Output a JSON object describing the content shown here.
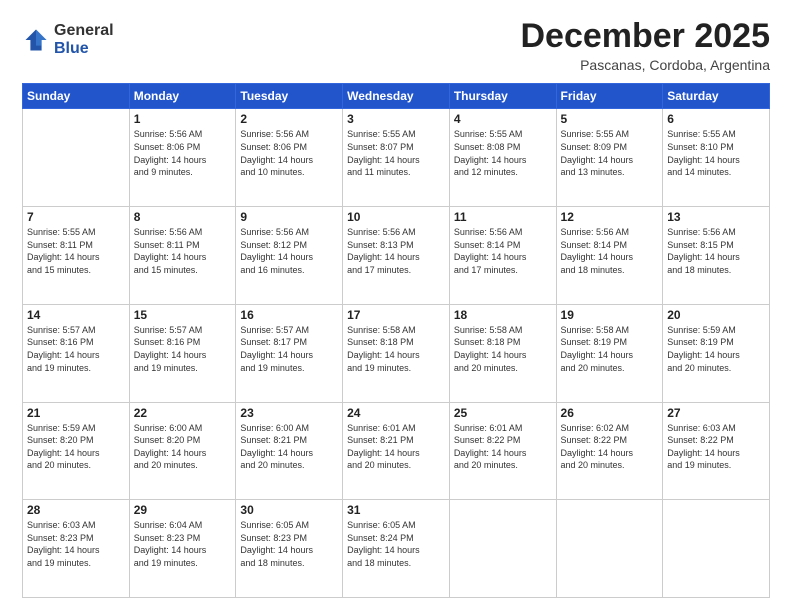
{
  "logo": {
    "general": "General",
    "blue": "Blue"
  },
  "header": {
    "month": "December 2025",
    "location": "Pascanas, Cordoba, Argentina"
  },
  "days_of_week": [
    "Sunday",
    "Monday",
    "Tuesday",
    "Wednesday",
    "Thursday",
    "Friday",
    "Saturday"
  ],
  "weeks": [
    [
      {
        "day": "",
        "info": ""
      },
      {
        "day": "1",
        "info": "Sunrise: 5:56 AM\nSunset: 8:06 PM\nDaylight: 14 hours\nand 9 minutes."
      },
      {
        "day": "2",
        "info": "Sunrise: 5:56 AM\nSunset: 8:06 PM\nDaylight: 14 hours\nand 10 minutes."
      },
      {
        "day": "3",
        "info": "Sunrise: 5:55 AM\nSunset: 8:07 PM\nDaylight: 14 hours\nand 11 minutes."
      },
      {
        "day": "4",
        "info": "Sunrise: 5:55 AM\nSunset: 8:08 PM\nDaylight: 14 hours\nand 12 minutes."
      },
      {
        "day": "5",
        "info": "Sunrise: 5:55 AM\nSunset: 8:09 PM\nDaylight: 14 hours\nand 13 minutes."
      },
      {
        "day": "6",
        "info": "Sunrise: 5:55 AM\nSunset: 8:10 PM\nDaylight: 14 hours\nand 14 minutes."
      }
    ],
    [
      {
        "day": "7",
        "info": "Sunrise: 5:55 AM\nSunset: 8:11 PM\nDaylight: 14 hours\nand 15 minutes."
      },
      {
        "day": "8",
        "info": "Sunrise: 5:56 AM\nSunset: 8:11 PM\nDaylight: 14 hours\nand 15 minutes."
      },
      {
        "day": "9",
        "info": "Sunrise: 5:56 AM\nSunset: 8:12 PM\nDaylight: 14 hours\nand 16 minutes."
      },
      {
        "day": "10",
        "info": "Sunrise: 5:56 AM\nSunset: 8:13 PM\nDaylight: 14 hours\nand 17 minutes."
      },
      {
        "day": "11",
        "info": "Sunrise: 5:56 AM\nSunset: 8:14 PM\nDaylight: 14 hours\nand 17 minutes."
      },
      {
        "day": "12",
        "info": "Sunrise: 5:56 AM\nSunset: 8:14 PM\nDaylight: 14 hours\nand 18 minutes."
      },
      {
        "day": "13",
        "info": "Sunrise: 5:56 AM\nSunset: 8:15 PM\nDaylight: 14 hours\nand 18 minutes."
      }
    ],
    [
      {
        "day": "14",
        "info": "Sunrise: 5:57 AM\nSunset: 8:16 PM\nDaylight: 14 hours\nand 19 minutes."
      },
      {
        "day": "15",
        "info": "Sunrise: 5:57 AM\nSunset: 8:16 PM\nDaylight: 14 hours\nand 19 minutes."
      },
      {
        "day": "16",
        "info": "Sunrise: 5:57 AM\nSunset: 8:17 PM\nDaylight: 14 hours\nand 19 minutes."
      },
      {
        "day": "17",
        "info": "Sunrise: 5:58 AM\nSunset: 8:18 PM\nDaylight: 14 hours\nand 19 minutes."
      },
      {
        "day": "18",
        "info": "Sunrise: 5:58 AM\nSunset: 8:18 PM\nDaylight: 14 hours\nand 20 minutes."
      },
      {
        "day": "19",
        "info": "Sunrise: 5:58 AM\nSunset: 8:19 PM\nDaylight: 14 hours\nand 20 minutes."
      },
      {
        "day": "20",
        "info": "Sunrise: 5:59 AM\nSunset: 8:19 PM\nDaylight: 14 hours\nand 20 minutes."
      }
    ],
    [
      {
        "day": "21",
        "info": "Sunrise: 5:59 AM\nSunset: 8:20 PM\nDaylight: 14 hours\nand 20 minutes."
      },
      {
        "day": "22",
        "info": "Sunrise: 6:00 AM\nSunset: 8:20 PM\nDaylight: 14 hours\nand 20 minutes."
      },
      {
        "day": "23",
        "info": "Sunrise: 6:00 AM\nSunset: 8:21 PM\nDaylight: 14 hours\nand 20 minutes."
      },
      {
        "day": "24",
        "info": "Sunrise: 6:01 AM\nSunset: 8:21 PM\nDaylight: 14 hours\nand 20 minutes."
      },
      {
        "day": "25",
        "info": "Sunrise: 6:01 AM\nSunset: 8:22 PM\nDaylight: 14 hours\nand 20 minutes."
      },
      {
        "day": "26",
        "info": "Sunrise: 6:02 AM\nSunset: 8:22 PM\nDaylight: 14 hours\nand 20 minutes."
      },
      {
        "day": "27",
        "info": "Sunrise: 6:03 AM\nSunset: 8:22 PM\nDaylight: 14 hours\nand 19 minutes."
      }
    ],
    [
      {
        "day": "28",
        "info": "Sunrise: 6:03 AM\nSunset: 8:23 PM\nDaylight: 14 hours\nand 19 minutes."
      },
      {
        "day": "29",
        "info": "Sunrise: 6:04 AM\nSunset: 8:23 PM\nDaylight: 14 hours\nand 19 minutes."
      },
      {
        "day": "30",
        "info": "Sunrise: 6:05 AM\nSunset: 8:23 PM\nDaylight: 14 hours\nand 18 minutes."
      },
      {
        "day": "31",
        "info": "Sunrise: 6:05 AM\nSunset: 8:24 PM\nDaylight: 14 hours\nand 18 minutes."
      },
      {
        "day": "",
        "info": ""
      },
      {
        "day": "",
        "info": ""
      },
      {
        "day": "",
        "info": ""
      }
    ]
  ]
}
